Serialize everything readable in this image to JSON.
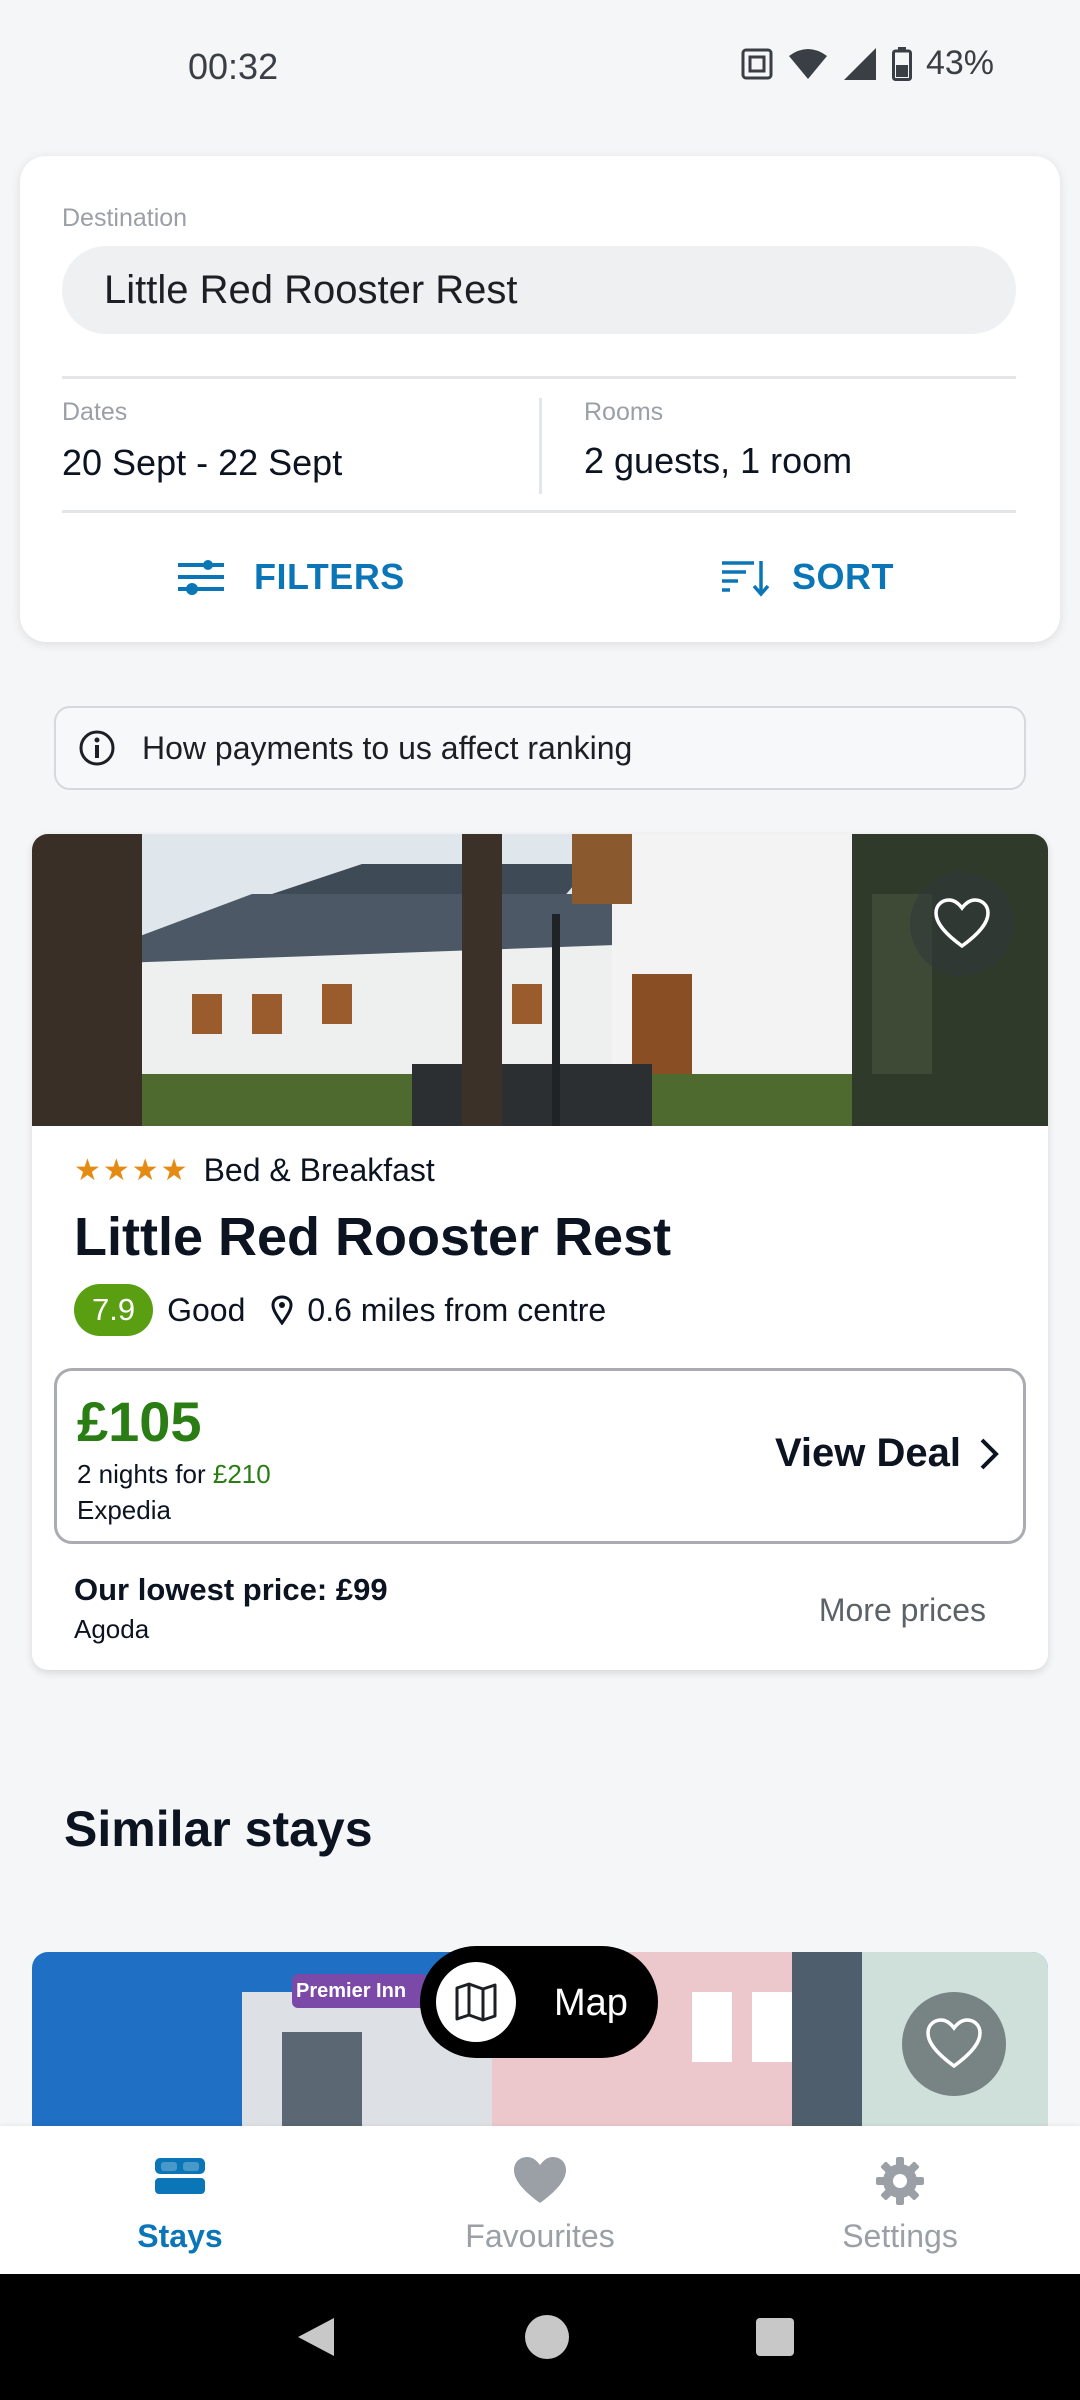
{
  "status_bar": {
    "time": "00:32",
    "battery": "43%"
  },
  "search": {
    "destination_label": "Destination",
    "destination_value": "Little Red Rooster Rest",
    "dates_label": "Dates",
    "dates_value": "20 Sept - 22 Sept",
    "rooms_label": "Rooms",
    "rooms_value": "2 guests, 1 room",
    "filters_label": "FILTERS",
    "sort_label": "SORT"
  },
  "payments_note": "How payments to us affect ranking",
  "hotel": {
    "stars": "★★★★",
    "type": "Bed & Breakfast",
    "name": "Little Red Rooster Rest",
    "rating": "7.9",
    "rating_text": "Good",
    "distance": "0.6 miles from centre",
    "price": "£105",
    "nights_prefix": "2 nights for ",
    "nights_total": "£210",
    "provider": "Expedia",
    "view_deal": "View Deal",
    "lowest_price": "Our lowest price: £99",
    "lowest_provider": "Agoda",
    "more_prices": "More prices"
  },
  "similar": {
    "title": "Similar stays",
    "sign_text": "Premier Inn"
  },
  "map_button": {
    "label": "Map"
  },
  "bottom_nav": [
    {
      "label": "Stays",
      "icon": "bed-icon",
      "active": true
    },
    {
      "label": "Favourites",
      "icon": "heart-icon",
      "active": false
    },
    {
      "label": "Settings",
      "icon": "gear-icon",
      "active": false
    }
  ],
  "colors": {
    "accent": "#0b76b7",
    "price_green": "#2a7d14",
    "rating_green": "#5a9e12",
    "star_orange": "#e58a12",
    "inactive_nav": "#9aa0a6"
  }
}
